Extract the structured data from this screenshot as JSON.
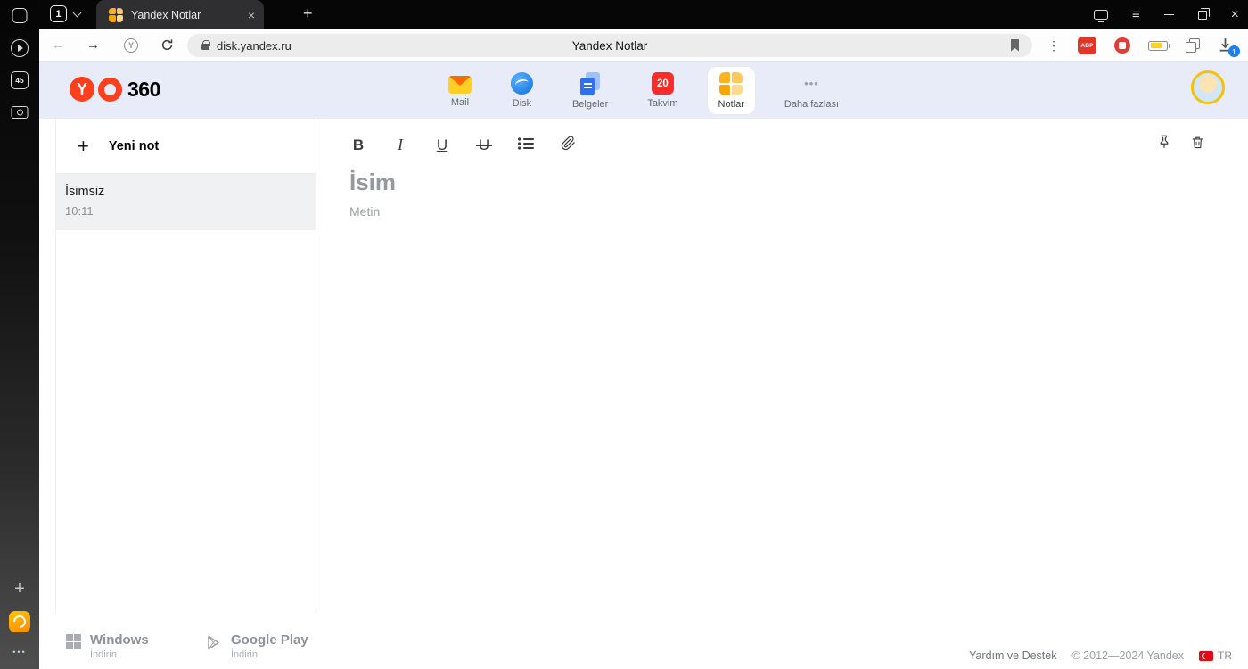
{
  "browser": {
    "sidebar": {
      "counter_badge": "45"
    },
    "tab_strip": {
      "tab_counter": "1",
      "active_tab": "Yandex Notlar"
    },
    "nav": {
      "url": "disk.yandex.ru",
      "page_title": "Yandex Notlar",
      "abp": "ABP",
      "download_badge": "1"
    }
  },
  "header": {
    "logo": {
      "y": "Y",
      "suffix": "360"
    },
    "apps": [
      {
        "label": "Mail"
      },
      {
        "label": "Disk"
      },
      {
        "label": "Belgeler"
      },
      {
        "label": "Takvim",
        "badge": "20"
      },
      {
        "label": "Notlar",
        "active": true
      },
      {
        "label": "Daha fazlası"
      }
    ]
  },
  "notes_list": {
    "new_note": "Yeni not",
    "items": [
      {
        "title": "İsimsiz",
        "time": "10:11"
      }
    ]
  },
  "editor": {
    "toolbar": {
      "bold": "B",
      "italic": "I",
      "underline": "U",
      "strikethrough": "U"
    },
    "title_placeholder": "İsim",
    "body_placeholder": "Metin"
  },
  "footer": {
    "windows_name": "Windows",
    "windows_action": "İndirin",
    "gplay_name": "Google Play",
    "gplay_action": "İndirin",
    "help": "Yardım ve Destek",
    "copyright": "© 2012—2024 Yandex",
    "lang": "TR"
  },
  "icons": {
    "plus": "+",
    "new_tab": "+",
    "more": "•••",
    "close": "×",
    "menu": "≡",
    "back": "←",
    "forward": "→",
    "protect": "Y",
    "dots": "⋮"
  },
  "colors": {
    "yandex_red": "#fc3f1d",
    "header_band": "#e8ecf8",
    "download_badge_blue": "#1e7df0"
  }
}
